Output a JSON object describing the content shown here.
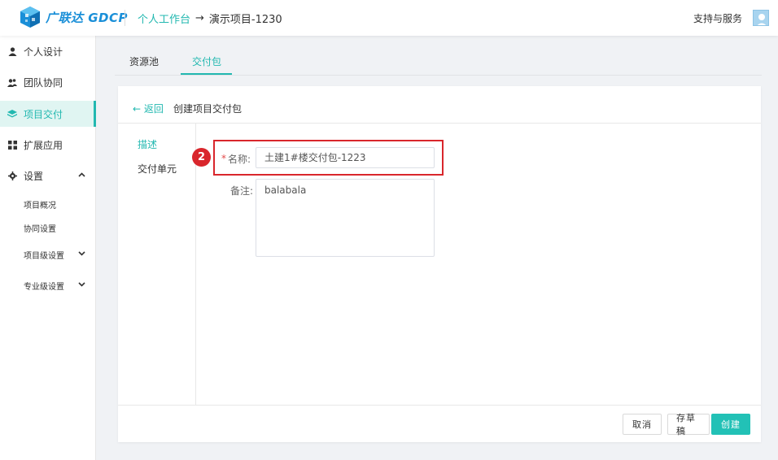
{
  "header": {
    "logo_text": "广联达",
    "logo_brand": "GDCP",
    "breadcrumb": [
      {
        "label": "个人工作台"
      },
      {
        "label": "演示项目-1230"
      }
    ],
    "breadcrumb_sep": "→",
    "support": "支持与服务"
  },
  "sidebar": {
    "items": [
      {
        "label": "个人设计",
        "icon": "user-icon"
      },
      {
        "label": "团队协同",
        "icon": "team-icon"
      },
      {
        "label": "项目交付",
        "icon": "layers-icon",
        "active": true
      },
      {
        "label": "扩展应用",
        "icon": "apps-icon"
      },
      {
        "label": "设置",
        "icon": "gear-icon",
        "caret": "⌃"
      }
    ],
    "sub_items": [
      {
        "label": "项目概况"
      },
      {
        "label": "协同设置"
      },
      {
        "label": "项目级设置",
        "caret": "⌄"
      },
      {
        "label": "专业级设置",
        "caret": "⌄"
      }
    ]
  },
  "tabs": [
    {
      "label": "资源池"
    },
    {
      "label": "交付包",
      "active": true
    }
  ],
  "panel": {
    "back_label": "← 返回",
    "title": "创建项目交付包",
    "left_items": [
      {
        "label": "描述",
        "active": true
      },
      {
        "label": "交付单元"
      }
    ],
    "form": {
      "required_mark": "*",
      "name_label": "名称:",
      "name_value": "土建1#楼交付包-1223",
      "note_label": "备注:",
      "note_value": "balabala"
    },
    "buttons": {
      "cancel": "取消",
      "draft": "存草稿",
      "create": "创建"
    }
  },
  "annotation": {
    "step_number": "2",
    "color": "#d9262c"
  },
  "colors": {
    "accent": "#22b8b0",
    "primary_button": "#22c1b6",
    "logo": "#1a8fd8"
  }
}
